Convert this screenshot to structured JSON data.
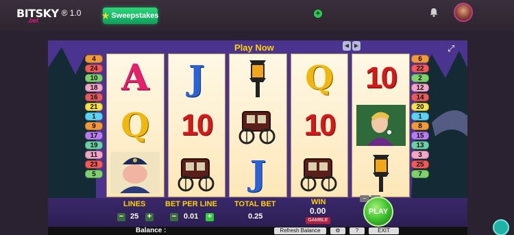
{
  "topbar": {
    "brand": "BITSKY",
    "brand_sub": ".bet",
    "version": "® 1.0",
    "sweepstakes_label": "Sweepstakes",
    "icons": [
      "plus-circle-icon",
      "bell-icon",
      "avatar"
    ]
  },
  "game": {
    "header": "Play Now",
    "left_paylines": [
      "4",
      "24",
      "10",
      "18",
      "16",
      "21",
      "1",
      "9",
      "17",
      "19",
      "11",
      "23",
      "5"
    ],
    "right_paylines": [
      "6",
      "22",
      "2",
      "12",
      "14",
      "20",
      "1",
      "8",
      "15",
      "13",
      "3",
      "25",
      "7"
    ],
    "reels": [
      [
        "A",
        "Q",
        "policeman"
      ],
      [
        "J",
        "10",
        "carriage"
      ],
      [
        "lamp",
        "carriage",
        "J"
      ],
      [
        "Q",
        "10",
        "carriage"
      ],
      [
        "10",
        "gentleman",
        "lamp"
      ]
    ],
    "controls": {
      "lines_label": "LINES",
      "lines_value": "25",
      "bet_label": "BET PER LINE",
      "bet_value": "0.01",
      "total_label": "TOTAL BET",
      "total_value": "0.25",
      "win_label": "WIN",
      "win_value": "0.00",
      "gamble_label": "GAMBLE",
      "spin_label": "PLAY"
    },
    "bottom": {
      "balance_label": "Balance :",
      "refresh_label": "Refresh Balance",
      "help_label": "?",
      "exit_label": "EXIT"
    }
  },
  "colors": {
    "accent_green": "#22c46a",
    "label_yellow": "#ffd200",
    "brand_pink": "#e2197d"
  }
}
